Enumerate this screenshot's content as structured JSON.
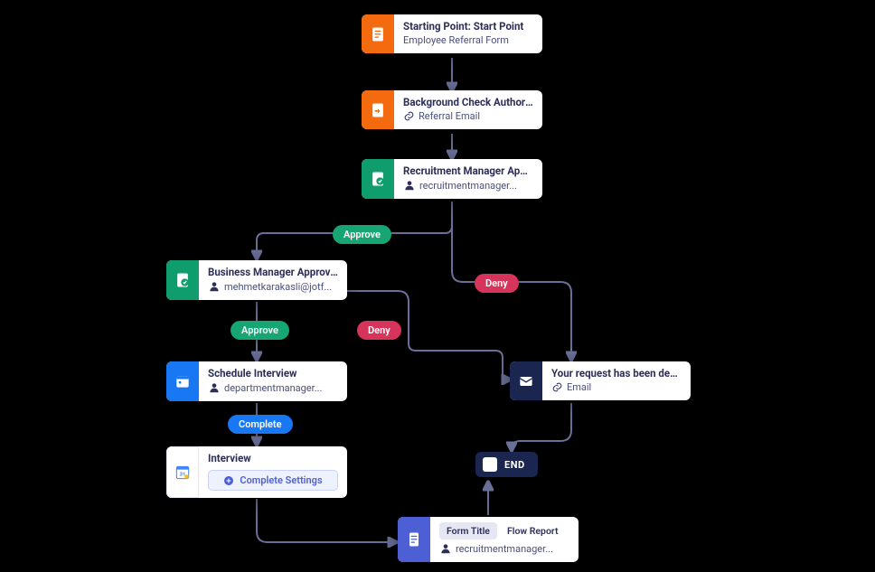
{
  "nodes": {
    "start": {
      "title": "Starting Point: Start Point",
      "subtitle": "Employee Referral Form"
    },
    "bgcheck": {
      "title": "Background Check Authoriz...",
      "subtitle": "Referral Email"
    },
    "recruit_appr": {
      "title": "Recruitment Manager Appro...",
      "subtitle": "recruitmentmanager..."
    },
    "biz_appr": {
      "title": "Business Manager Approval",
      "subtitle": "mehmetkarakasli@jotf..."
    },
    "schedule": {
      "title": "Schedule Interview",
      "subtitle": "departmentmanager..."
    },
    "interview": {
      "title": "Interview",
      "settings_label": "Complete Settings"
    },
    "denied": {
      "title": "Your request has been denied.",
      "subtitle": "Email"
    },
    "report": {
      "tab_form": "Form Title",
      "tab_flow": "Flow Report",
      "subtitle": "recruitmentmanager..."
    },
    "end": {
      "label": "END"
    }
  },
  "edges": {
    "approve1": "Approve",
    "deny1": "Deny",
    "approve2": "Approve",
    "deny2": "Deny",
    "complete": "Complete"
  }
}
